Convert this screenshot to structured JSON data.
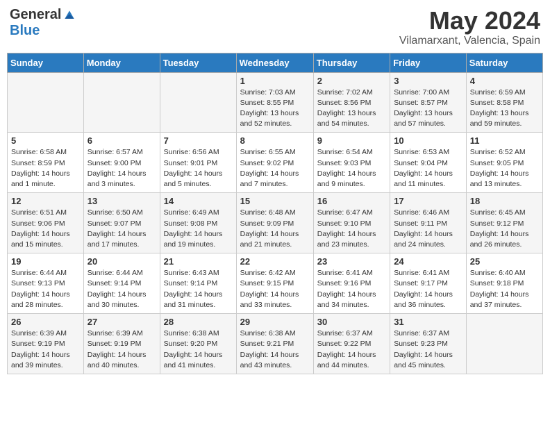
{
  "header": {
    "logo_general": "General",
    "logo_blue": "Blue",
    "month": "May 2024",
    "location": "Vilamarxant, Valencia, Spain"
  },
  "days_of_week": [
    "Sunday",
    "Monday",
    "Tuesday",
    "Wednesday",
    "Thursday",
    "Friday",
    "Saturday"
  ],
  "weeks": [
    [
      {
        "day": "",
        "info": ""
      },
      {
        "day": "",
        "info": ""
      },
      {
        "day": "",
        "info": ""
      },
      {
        "day": "1",
        "info": "Sunrise: 7:03 AM\nSunset: 8:55 PM\nDaylight: 13 hours and 52 minutes."
      },
      {
        "day": "2",
        "info": "Sunrise: 7:02 AM\nSunset: 8:56 PM\nDaylight: 13 hours and 54 minutes."
      },
      {
        "day": "3",
        "info": "Sunrise: 7:00 AM\nSunset: 8:57 PM\nDaylight: 13 hours and 57 minutes."
      },
      {
        "day": "4",
        "info": "Sunrise: 6:59 AM\nSunset: 8:58 PM\nDaylight: 13 hours and 59 minutes."
      }
    ],
    [
      {
        "day": "5",
        "info": "Sunrise: 6:58 AM\nSunset: 8:59 PM\nDaylight: 14 hours and 1 minute."
      },
      {
        "day": "6",
        "info": "Sunrise: 6:57 AM\nSunset: 9:00 PM\nDaylight: 14 hours and 3 minutes."
      },
      {
        "day": "7",
        "info": "Sunrise: 6:56 AM\nSunset: 9:01 PM\nDaylight: 14 hours and 5 minutes."
      },
      {
        "day": "8",
        "info": "Sunrise: 6:55 AM\nSunset: 9:02 PM\nDaylight: 14 hours and 7 minutes."
      },
      {
        "day": "9",
        "info": "Sunrise: 6:54 AM\nSunset: 9:03 PM\nDaylight: 14 hours and 9 minutes."
      },
      {
        "day": "10",
        "info": "Sunrise: 6:53 AM\nSunset: 9:04 PM\nDaylight: 14 hours and 11 minutes."
      },
      {
        "day": "11",
        "info": "Sunrise: 6:52 AM\nSunset: 9:05 PM\nDaylight: 14 hours and 13 minutes."
      }
    ],
    [
      {
        "day": "12",
        "info": "Sunrise: 6:51 AM\nSunset: 9:06 PM\nDaylight: 14 hours and 15 minutes."
      },
      {
        "day": "13",
        "info": "Sunrise: 6:50 AM\nSunset: 9:07 PM\nDaylight: 14 hours and 17 minutes."
      },
      {
        "day": "14",
        "info": "Sunrise: 6:49 AM\nSunset: 9:08 PM\nDaylight: 14 hours and 19 minutes."
      },
      {
        "day": "15",
        "info": "Sunrise: 6:48 AM\nSunset: 9:09 PM\nDaylight: 14 hours and 21 minutes."
      },
      {
        "day": "16",
        "info": "Sunrise: 6:47 AM\nSunset: 9:10 PM\nDaylight: 14 hours and 23 minutes."
      },
      {
        "day": "17",
        "info": "Sunrise: 6:46 AM\nSunset: 9:11 PM\nDaylight: 14 hours and 24 minutes."
      },
      {
        "day": "18",
        "info": "Sunrise: 6:45 AM\nSunset: 9:12 PM\nDaylight: 14 hours and 26 minutes."
      }
    ],
    [
      {
        "day": "19",
        "info": "Sunrise: 6:44 AM\nSunset: 9:13 PM\nDaylight: 14 hours and 28 minutes."
      },
      {
        "day": "20",
        "info": "Sunrise: 6:44 AM\nSunset: 9:14 PM\nDaylight: 14 hours and 30 minutes."
      },
      {
        "day": "21",
        "info": "Sunrise: 6:43 AM\nSunset: 9:14 PM\nDaylight: 14 hours and 31 minutes."
      },
      {
        "day": "22",
        "info": "Sunrise: 6:42 AM\nSunset: 9:15 PM\nDaylight: 14 hours and 33 minutes."
      },
      {
        "day": "23",
        "info": "Sunrise: 6:41 AM\nSunset: 9:16 PM\nDaylight: 14 hours and 34 minutes."
      },
      {
        "day": "24",
        "info": "Sunrise: 6:41 AM\nSunset: 9:17 PM\nDaylight: 14 hours and 36 minutes."
      },
      {
        "day": "25",
        "info": "Sunrise: 6:40 AM\nSunset: 9:18 PM\nDaylight: 14 hours and 37 minutes."
      }
    ],
    [
      {
        "day": "26",
        "info": "Sunrise: 6:39 AM\nSunset: 9:19 PM\nDaylight: 14 hours and 39 minutes."
      },
      {
        "day": "27",
        "info": "Sunrise: 6:39 AM\nSunset: 9:19 PM\nDaylight: 14 hours and 40 minutes."
      },
      {
        "day": "28",
        "info": "Sunrise: 6:38 AM\nSunset: 9:20 PM\nDaylight: 14 hours and 41 minutes."
      },
      {
        "day": "29",
        "info": "Sunrise: 6:38 AM\nSunset: 9:21 PM\nDaylight: 14 hours and 43 minutes."
      },
      {
        "day": "30",
        "info": "Sunrise: 6:37 AM\nSunset: 9:22 PM\nDaylight: 14 hours and 44 minutes."
      },
      {
        "day": "31",
        "info": "Sunrise: 6:37 AM\nSunset: 9:23 PM\nDaylight: 14 hours and 45 minutes."
      },
      {
        "day": "",
        "info": ""
      }
    ]
  ]
}
